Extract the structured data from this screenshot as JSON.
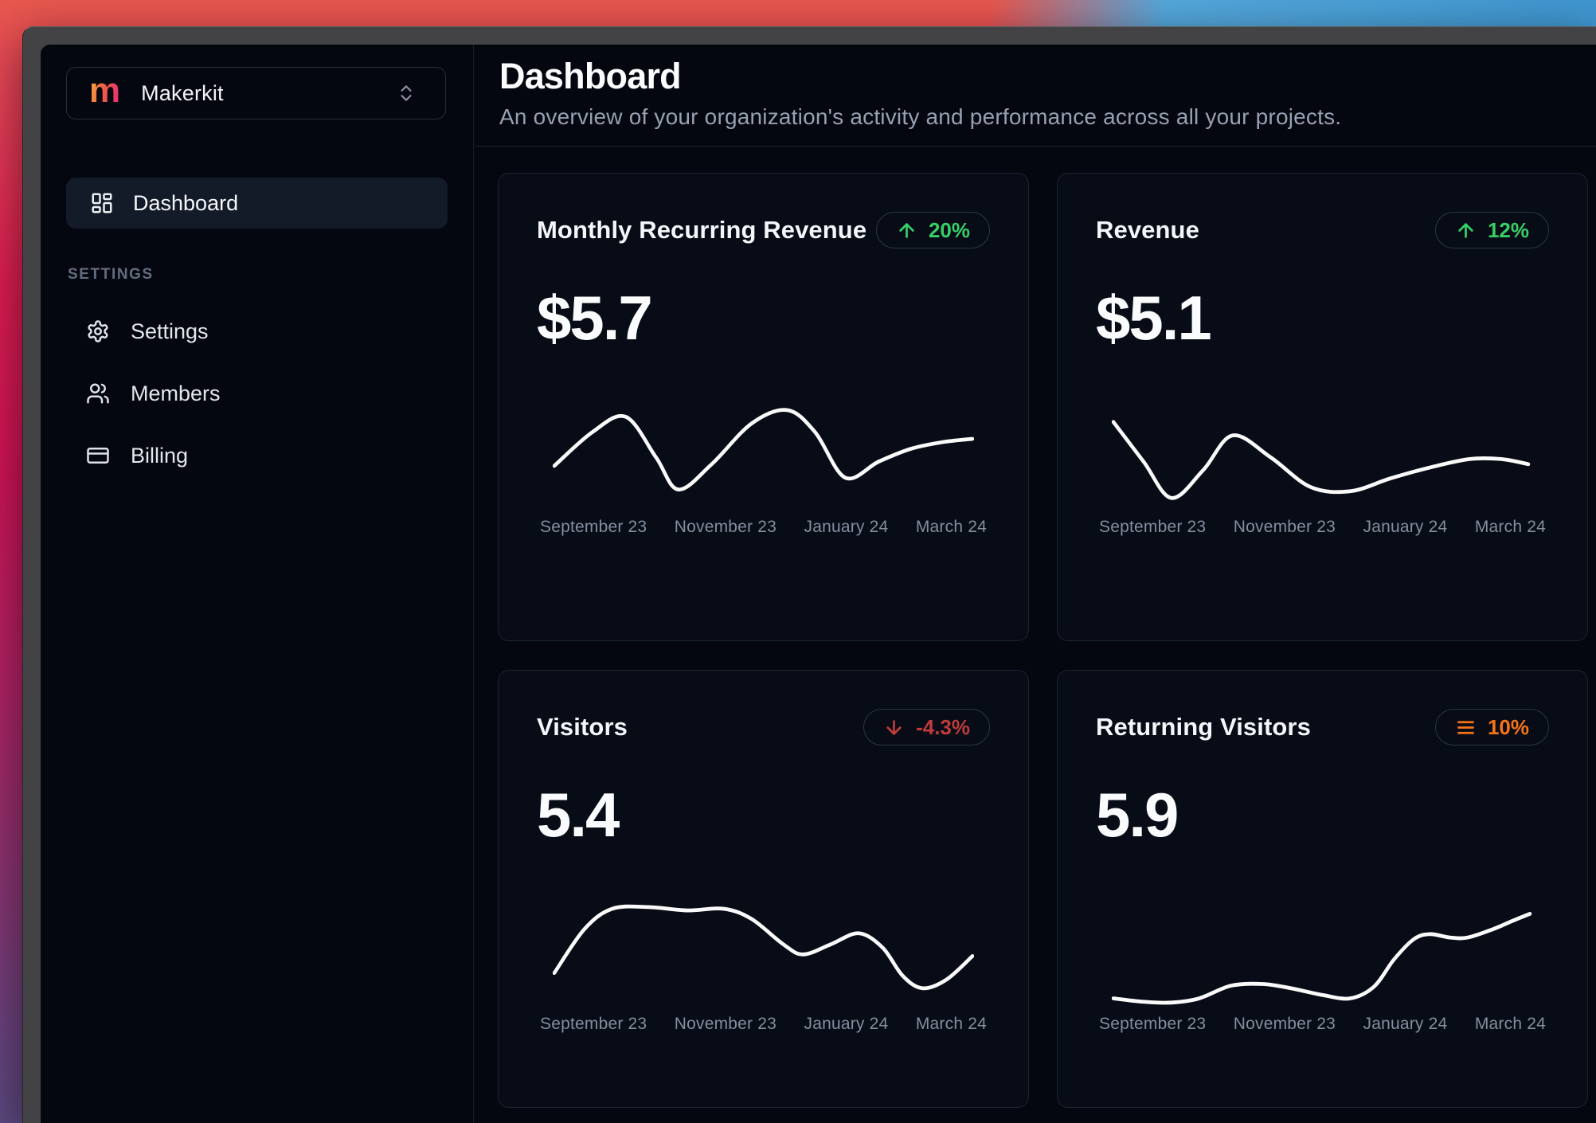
{
  "workspace": {
    "logo_letter": "m",
    "name": "Makerkit"
  },
  "sidebar": {
    "nav": [
      {
        "label": "Dashboard"
      }
    ],
    "section_label": "SETTINGS",
    "items": [
      {
        "label": "Settings"
      },
      {
        "label": "Members"
      },
      {
        "label": "Billing"
      }
    ]
  },
  "header": {
    "title": "Dashboard",
    "subtitle": "An overview of your organization's activity and performance across all your projects."
  },
  "cards": [
    {
      "title": "Monthly Recurring Revenue",
      "value": "$5.7",
      "trend": "up",
      "trend_label": "20%"
    },
    {
      "title": "Revenue",
      "value": "$5.1",
      "trend": "up",
      "trend_label": "12%"
    },
    {
      "title": "Visitors",
      "value": "5.4",
      "trend": "down",
      "trend_label": "-4.3%"
    },
    {
      "title": "Returning Visitors",
      "value": "5.9",
      "trend": "flat",
      "trend_label": "10%"
    }
  ],
  "chart_data": [
    {
      "type": "line",
      "series": "Monthly Recurring Revenue",
      "legend": "none",
      "grid": false,
      "x_labels": [
        "September 23",
        "November 23",
        "January 24",
        "March 24"
      ],
      "points": [
        [
          2,
          80
        ],
        [
          50,
          40
        ],
        [
          92,
          22
        ],
        [
          130,
          70
        ],
        [
          158,
          108
        ],
        [
          200,
          78
        ],
        [
          250,
          30
        ],
        [
          295,
          14
        ],
        [
          330,
          40
        ],
        [
          368,
          94
        ],
        [
          410,
          75
        ],
        [
          450,
          60
        ],
        [
          490,
          52
        ],
        [
          528,
          48
        ]
      ]
    },
    {
      "type": "line",
      "series": "Revenue",
      "legend": "none",
      "grid": false,
      "x_labels": [
        "September 23",
        "November 23",
        "January 24",
        "March 24"
      ],
      "points": [
        [
          2,
          28
        ],
        [
          40,
          75
        ],
        [
          75,
          118
        ],
        [
          115,
          85
        ],
        [
          152,
          44
        ],
        [
          200,
          70
        ],
        [
          250,
          105
        ],
        [
          300,
          110
        ],
        [
          350,
          95
        ],
        [
          400,
          82
        ],
        [
          450,
          72
        ],
        [
          490,
          72
        ],
        [
          524,
          78
        ]
      ]
    },
    {
      "type": "line",
      "series": "Visitors",
      "legend": "none",
      "grid": false,
      "x_labels": [
        "September 23",
        "November 23",
        "January 24",
        "March 24"
      ],
      "points": [
        [
          2,
          92
        ],
        [
          40,
          40
        ],
        [
          75,
          16
        ],
        [
          120,
          14
        ],
        [
          170,
          18
        ],
        [
          215,
          16
        ],
        [
          250,
          28
        ],
        [
          290,
          58
        ],
        [
          315,
          70
        ],
        [
          350,
          58
        ],
        [
          385,
          45
        ],
        [
          415,
          62
        ],
        [
          440,
          95
        ],
        [
          465,
          110
        ],
        [
          495,
          100
        ],
        [
          528,
          72
        ]
      ]
    },
    {
      "type": "line",
      "series": "Returning Visitors",
      "legend": "none",
      "grid": false,
      "x_labels": [
        "September 23",
        "November 23",
        "January 24",
        "March 24"
      ],
      "points": [
        [
          2,
          122
        ],
        [
          40,
          126
        ],
        [
          75,
          127
        ],
        [
          110,
          122
        ],
        [
          150,
          107
        ],
        [
          190,
          105
        ],
        [
          225,
          110
        ],
        [
          265,
          118
        ],
        [
          300,
          122
        ],
        [
          330,
          108
        ],
        [
          355,
          76
        ],
        [
          380,
          52
        ],
        [
          400,
          46
        ],
        [
          425,
          50
        ],
        [
          448,
          50
        ],
        [
          480,
          40
        ],
        [
          505,
          30
        ],
        [
          526,
          22
        ]
      ]
    }
  ],
  "colors": {
    "green": "#37cf67",
    "red": "#c03b3b",
    "orange": "#f97316",
    "line": "#fafafa"
  }
}
